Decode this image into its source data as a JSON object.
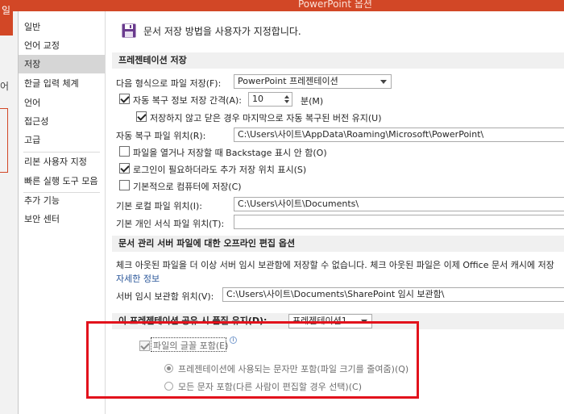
{
  "window": {
    "title": "PowerPoint 옵션"
  },
  "background": {
    "left_char_1": "일",
    "left_char_2": "어"
  },
  "sidebar": {
    "items": [
      {
        "label": "일반"
      },
      {
        "label": "언어 교정"
      },
      {
        "label": "저장",
        "selected": true
      },
      {
        "label": "한글 입력 체계"
      },
      {
        "label": "언어"
      },
      {
        "label": "접근성"
      },
      {
        "label": "고급"
      },
      {
        "label": "리본 사용자 지정"
      },
      {
        "label": "빠른 실행 도구 모음"
      },
      {
        "label": "추가 기능"
      },
      {
        "label": "보안 센터"
      }
    ]
  },
  "header": {
    "icon": "save-icon",
    "text": "문서 저장 방법을 사용자가 지정합니다."
  },
  "save_section": {
    "title": "프레젠테이션 저장",
    "format_label": "다음 형식으로 파일 저장(F):",
    "format_value": "PowerPoint 프레젠테이션",
    "autorecover_label": "자동 복구 정보 저장 간격(A):",
    "autorecover_checked": true,
    "autorecover_minutes": "10",
    "minutes_label": "분(M)",
    "keep_last_label": "저장하지 않고 닫은 경우 마지막으로 자동 복구된 버전 유지(U)",
    "keep_last_checked": true,
    "autorecover_location_label": "자동 복구 파일 위치(R):",
    "autorecover_location_value": "C:\\Users\\사이트\\AppData\\Roaming\\Microsoft\\PowerPoint\\",
    "no_backstage_label": "파일을 열거나 저장할 때 Backstage 표시 안 함(O)",
    "no_backstage_checked": false,
    "show_additional_label": "로그인이 필요하더라도 추가 저장 위치 표시(S)",
    "show_additional_checked": true,
    "save_to_computer_label": "기본적으로 컴퓨터에 저장(C)",
    "save_to_computer_checked": false,
    "default_local_label": "기본 로컬 파일 위치(I):",
    "default_local_value": "C:\\Users\\사이트\\Documents\\",
    "default_personal_label": "기본 개인 서식 파일 위치(T):",
    "default_personal_value": ""
  },
  "offline_section": {
    "title": "문서 관리 서버 파일에 대한 오프라인 편집 옵션",
    "description": "체크 아웃된 파일을 더 이상 서버 임시 보관함에 저장할 수 없습니다. 체크 아웃된 파일은 이제 Office 문서 캐시에 저장",
    "more_info_link": "자세한 정보",
    "server_drafts_label": "서버 임시 보관함 위치(V):",
    "server_drafts_value": "C:\\Users\\사이트\\Documents\\SharePoint 임시 보관함\\"
  },
  "fidelity_section": {
    "title": "이 프레젠테이션 공유 시 품질 유지(D):",
    "presentation_value": "프레젠테이션1",
    "embed_fonts_label": "파일의 글꼴 포함(E)",
    "embed_fonts_checked": true,
    "embed_used_only_label": "프레젠테이션에 사용되는 문자만 포함(파일 크기를 줄여줌)(Q)",
    "embed_used_only_selected": true,
    "embed_all_label": "모든 문자 포함(다른 사람이 편집할 경우 선택)(C)",
    "embed_all_selected": false
  },
  "colors": {
    "accent": "#d24726",
    "highlight": "#e2121c",
    "link": "#2b579a"
  }
}
